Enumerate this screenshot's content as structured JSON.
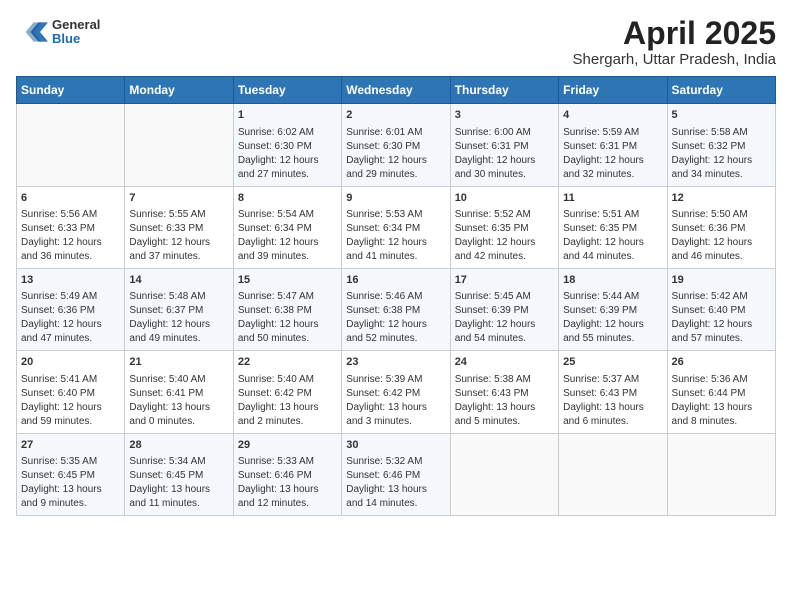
{
  "header": {
    "logo": {
      "general": "General",
      "blue": "Blue"
    },
    "title": "April 2025",
    "subtitle": "Shergarh, Uttar Pradesh, India"
  },
  "days_of_week": [
    "Sunday",
    "Monday",
    "Tuesday",
    "Wednesday",
    "Thursday",
    "Friday",
    "Saturday"
  ],
  "weeks": [
    [
      {
        "day": "",
        "sunrise": "",
        "sunset": "",
        "daylight": ""
      },
      {
        "day": "",
        "sunrise": "",
        "sunset": "",
        "daylight": ""
      },
      {
        "day": "1",
        "sunrise": "Sunrise: 6:02 AM",
        "sunset": "Sunset: 6:30 PM",
        "daylight": "Daylight: 12 hours and 27 minutes."
      },
      {
        "day": "2",
        "sunrise": "Sunrise: 6:01 AM",
        "sunset": "Sunset: 6:30 PM",
        "daylight": "Daylight: 12 hours and 29 minutes."
      },
      {
        "day": "3",
        "sunrise": "Sunrise: 6:00 AM",
        "sunset": "Sunset: 6:31 PM",
        "daylight": "Daylight: 12 hours and 30 minutes."
      },
      {
        "day": "4",
        "sunrise": "Sunrise: 5:59 AM",
        "sunset": "Sunset: 6:31 PM",
        "daylight": "Daylight: 12 hours and 32 minutes."
      },
      {
        "day": "5",
        "sunrise": "Sunrise: 5:58 AM",
        "sunset": "Sunset: 6:32 PM",
        "daylight": "Daylight: 12 hours and 34 minutes."
      }
    ],
    [
      {
        "day": "6",
        "sunrise": "Sunrise: 5:56 AM",
        "sunset": "Sunset: 6:33 PM",
        "daylight": "Daylight: 12 hours and 36 minutes."
      },
      {
        "day": "7",
        "sunrise": "Sunrise: 5:55 AM",
        "sunset": "Sunset: 6:33 PM",
        "daylight": "Daylight: 12 hours and 37 minutes."
      },
      {
        "day": "8",
        "sunrise": "Sunrise: 5:54 AM",
        "sunset": "Sunset: 6:34 PM",
        "daylight": "Daylight: 12 hours and 39 minutes."
      },
      {
        "day": "9",
        "sunrise": "Sunrise: 5:53 AM",
        "sunset": "Sunset: 6:34 PM",
        "daylight": "Daylight: 12 hours and 41 minutes."
      },
      {
        "day": "10",
        "sunrise": "Sunrise: 5:52 AM",
        "sunset": "Sunset: 6:35 PM",
        "daylight": "Daylight: 12 hours and 42 minutes."
      },
      {
        "day": "11",
        "sunrise": "Sunrise: 5:51 AM",
        "sunset": "Sunset: 6:35 PM",
        "daylight": "Daylight: 12 hours and 44 minutes."
      },
      {
        "day": "12",
        "sunrise": "Sunrise: 5:50 AM",
        "sunset": "Sunset: 6:36 PM",
        "daylight": "Daylight: 12 hours and 46 minutes."
      }
    ],
    [
      {
        "day": "13",
        "sunrise": "Sunrise: 5:49 AM",
        "sunset": "Sunset: 6:36 PM",
        "daylight": "Daylight: 12 hours and 47 minutes."
      },
      {
        "day": "14",
        "sunrise": "Sunrise: 5:48 AM",
        "sunset": "Sunset: 6:37 PM",
        "daylight": "Daylight: 12 hours and 49 minutes."
      },
      {
        "day": "15",
        "sunrise": "Sunrise: 5:47 AM",
        "sunset": "Sunset: 6:38 PM",
        "daylight": "Daylight: 12 hours and 50 minutes."
      },
      {
        "day": "16",
        "sunrise": "Sunrise: 5:46 AM",
        "sunset": "Sunset: 6:38 PM",
        "daylight": "Daylight: 12 hours and 52 minutes."
      },
      {
        "day": "17",
        "sunrise": "Sunrise: 5:45 AM",
        "sunset": "Sunset: 6:39 PM",
        "daylight": "Daylight: 12 hours and 54 minutes."
      },
      {
        "day": "18",
        "sunrise": "Sunrise: 5:44 AM",
        "sunset": "Sunset: 6:39 PM",
        "daylight": "Daylight: 12 hours and 55 minutes."
      },
      {
        "day": "19",
        "sunrise": "Sunrise: 5:42 AM",
        "sunset": "Sunset: 6:40 PM",
        "daylight": "Daylight: 12 hours and 57 minutes."
      }
    ],
    [
      {
        "day": "20",
        "sunrise": "Sunrise: 5:41 AM",
        "sunset": "Sunset: 6:40 PM",
        "daylight": "Daylight: 12 hours and 59 minutes."
      },
      {
        "day": "21",
        "sunrise": "Sunrise: 5:40 AM",
        "sunset": "Sunset: 6:41 PM",
        "daylight": "Daylight: 13 hours and 0 minutes."
      },
      {
        "day": "22",
        "sunrise": "Sunrise: 5:40 AM",
        "sunset": "Sunset: 6:42 PM",
        "daylight": "Daylight: 13 hours and 2 minutes."
      },
      {
        "day": "23",
        "sunrise": "Sunrise: 5:39 AM",
        "sunset": "Sunset: 6:42 PM",
        "daylight": "Daylight: 13 hours and 3 minutes."
      },
      {
        "day": "24",
        "sunrise": "Sunrise: 5:38 AM",
        "sunset": "Sunset: 6:43 PM",
        "daylight": "Daylight: 13 hours and 5 minutes."
      },
      {
        "day": "25",
        "sunrise": "Sunrise: 5:37 AM",
        "sunset": "Sunset: 6:43 PM",
        "daylight": "Daylight: 13 hours and 6 minutes."
      },
      {
        "day": "26",
        "sunrise": "Sunrise: 5:36 AM",
        "sunset": "Sunset: 6:44 PM",
        "daylight": "Daylight: 13 hours and 8 minutes."
      }
    ],
    [
      {
        "day": "27",
        "sunrise": "Sunrise: 5:35 AM",
        "sunset": "Sunset: 6:45 PM",
        "daylight": "Daylight: 13 hours and 9 minutes."
      },
      {
        "day": "28",
        "sunrise": "Sunrise: 5:34 AM",
        "sunset": "Sunset: 6:45 PM",
        "daylight": "Daylight: 13 hours and 11 minutes."
      },
      {
        "day": "29",
        "sunrise": "Sunrise: 5:33 AM",
        "sunset": "Sunset: 6:46 PM",
        "daylight": "Daylight: 13 hours and 12 minutes."
      },
      {
        "day": "30",
        "sunrise": "Sunrise: 5:32 AM",
        "sunset": "Sunset: 6:46 PM",
        "daylight": "Daylight: 13 hours and 14 minutes."
      },
      {
        "day": "",
        "sunrise": "",
        "sunset": "",
        "daylight": ""
      },
      {
        "day": "",
        "sunrise": "",
        "sunset": "",
        "daylight": ""
      },
      {
        "day": "",
        "sunrise": "",
        "sunset": "",
        "daylight": ""
      }
    ]
  ]
}
